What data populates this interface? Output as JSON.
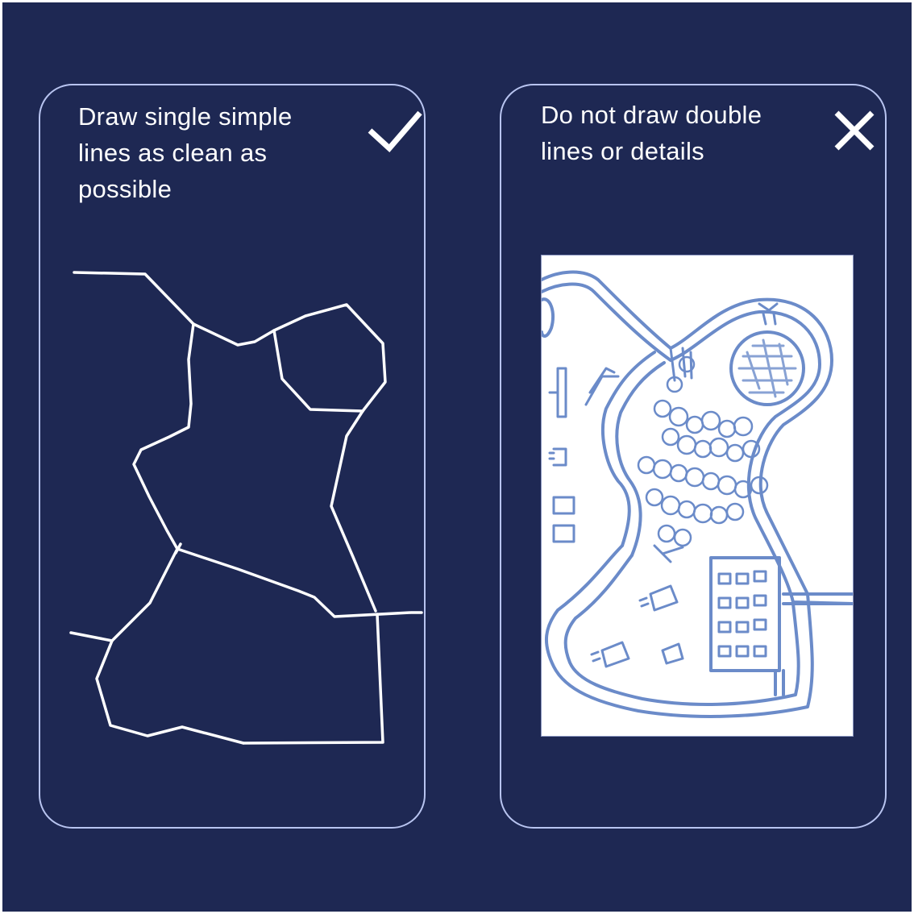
{
  "panels": {
    "do": {
      "text": "Draw single simple lines as clean as possible",
      "mark_icon": "checkmark-icon"
    },
    "dont": {
      "text": "Do not draw double lines or details",
      "mark_icon": "cross-icon"
    }
  },
  "colors": {
    "background": "#1e2853",
    "card_border": "#b8c4f0",
    "text": "#ffffff",
    "sketch_ink": "#5b7fc4"
  }
}
